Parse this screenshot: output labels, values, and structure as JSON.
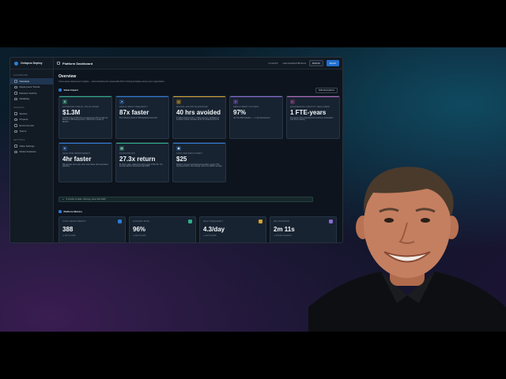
{
  "app": {
    "brand": "Octopus Deploy",
    "window_title": "Platform Dashboard",
    "period": "1 month",
    "last_refreshed": "Last refreshed 38 hours",
    "refresh_label": "Refresh",
    "export_label": "Export"
  },
  "sidebar": {
    "sections": [
      {
        "title": "Dashboard",
        "items": [
          {
            "label": "Overview",
            "active": true
          },
          {
            "label": "Deployment Trends",
            "active": false
          },
          {
            "label": "Release Velocity",
            "active": false
          },
          {
            "label": "Reliability",
            "active": false
          }
        ]
      },
      {
        "title": "Insights",
        "items": [
          {
            "label": "Spaces",
            "active": false
          },
          {
            "label": "Projects",
            "active": false
          },
          {
            "label": "Environments",
            "active": false
          },
          {
            "label": "Teams",
            "active": false
          }
        ]
      },
      {
        "title": "Settings",
        "items": [
          {
            "label": "Value Settings",
            "active": false
          },
          {
            "label": "Model Assistant",
            "active": false
          }
        ]
      }
    ]
  },
  "overview": {
    "title": "Overview",
    "subtitle": "Cross-space deployment insights — demonstrating the measurable ROI of Octopus Deploy across your organization.",
    "value_impact_title": "Value Impact",
    "edit_label": "Edit assumptions",
    "cards": [
      {
        "label": "Estimated annual value saved",
        "value": "$1.3M",
        "desc": "14,262 hours of FTE time & engineering effort reclaimed. Based on 388 deployments × 33min/ea × people at $100/hr",
        "color": "#2fae8a",
        "icon": "dollar-icon"
      },
      {
        "label": "Deployment frequency",
        "value": "87x faster",
        "desc": "From Weekly (1/wk) to 348 deployments/month",
        "color": "#2f7bd6",
        "icon": "rocket-icon"
      },
      {
        "label": "Manual effort eliminated",
        "value": "40 hrs avoided",
        "desc": "37 failed deployments × 1.5hrs recovery. Rollbacks & incident recovery avoided 18.5h of incidental process",
        "color": "#d9a22a",
        "icon": "clock-icon"
      },
      {
        "label": "Deployment success",
        "value": "97%",
        "desc": "Up from 88% baseline — +7.1pt improvement",
        "color": "#8a6ad6",
        "icon": "check-icon"
      },
      {
        "label": "Engineering capacity reclaimed",
        "value": "1 FTE-years",
        "desc": "Previously 70% of deployment resources. Automation now frees capacity",
        "color": "#b86ac0",
        "icon": "people-icon"
      },
      {
        "label": "Lead time improvement",
        "value": "4hr faster",
        "desc": "Manual was same day. Now near-instant with automated pipelines",
        "color": "#2f7bd6",
        "icon": "bolt-icon"
      },
      {
        "label": "Platform ROI",
        "value": "27.3x return",
        "desc": "$1.3M in value, against licensing costs of $27.5K. The annual platform investment was $48K",
        "color": "#2fae8a",
        "icon": "chart-icon"
      },
      {
        "label": "Cost per deployment",
        "value": "$25",
        "desc": "Platform cost per total deployments $48 / month 7760 deployments/mo. Net savings: down from $600 manually",
        "color": "#2f7bd6",
        "icon": "tag-icon"
      }
    ],
    "note": "3 months of data • 344 avg. since Feb 2026",
    "platform_metrics_title": "Platform Metrics",
    "metrics": [
      {
        "label": "Total deployments",
        "value": "388",
        "sub": "▲ last 3 months",
        "color": "#2f7bd6"
      },
      {
        "label": "Success rate",
        "value": "96%",
        "sub": "▲ last 3 months",
        "color": "#2fae8a"
      },
      {
        "label": "Daily frequency",
        "value": "4.3/day",
        "sub": "▲ last 3 months",
        "color": "#d9a22a"
      },
      {
        "label": "Avg duration",
        "value": "2m 11s",
        "sub": "▲ 287 jobs measured",
        "color": "#8a6ad6"
      }
    ]
  }
}
